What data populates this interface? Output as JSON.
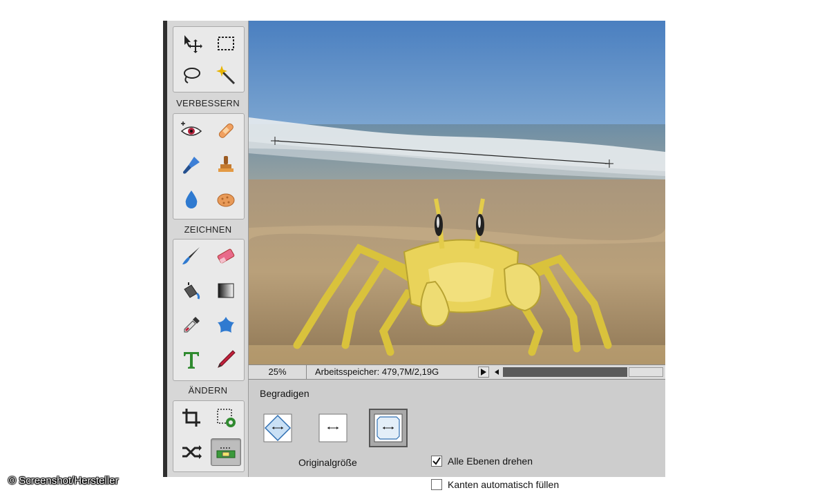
{
  "toolbar": {
    "sections": {
      "enhance": "VERBESSERN",
      "draw": "ZEICHNEN",
      "modify": "ÄNDERN"
    },
    "tools": {
      "select_group": [
        "move-tool",
        "rectangular-marquee-tool",
        "lasso-tool",
        "magic-wand-tool"
      ],
      "enhance_group": [
        "red-eye-removal-tool",
        "spot-healing-brush-tool",
        "smart-brush-tool",
        "clone-stamp-tool",
        "blur-tool",
        "sponge-tool"
      ],
      "draw_group": [
        "brush-tool",
        "eraser-tool",
        "paint-bucket-tool",
        "gradient-tool",
        "color-picker-tool",
        "custom-shape-tool",
        "type-tool",
        "pencil-tool"
      ],
      "modify_group": [
        "crop-tool",
        "recompose-tool",
        "content-aware-move-tool",
        "straighten-tool"
      ]
    },
    "active_tool": "straighten-tool"
  },
  "statusbar": {
    "zoom": "25%",
    "memory": "Arbeitsspeicher: 479,7M/2,19G"
  },
  "options": {
    "title": "Begradigen",
    "mode_caption": "Originalgröße",
    "checkboxes": [
      {
        "label": "Alle Ebenen drehen",
        "checked": true
      },
      {
        "label": "Kanten automatisch füllen",
        "checked": false
      }
    ]
  },
  "credit": "© Screenshot/Hersteller",
  "colors": {
    "sky": "#4f86c2",
    "sea": "#6f8fa6",
    "sand": "#b79c78",
    "crab": "#e9d35a",
    "panel": "#cdcdcd"
  }
}
